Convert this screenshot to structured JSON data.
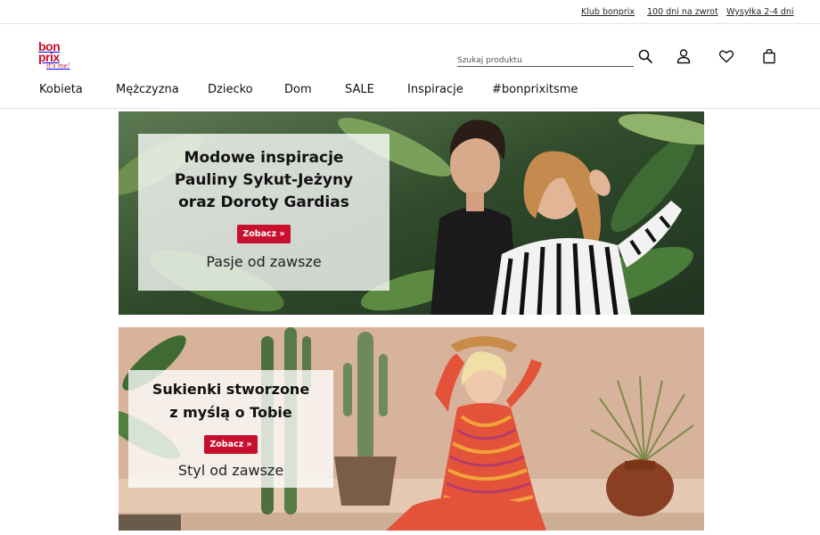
{
  "topbar": {
    "links": [
      "Klub bonprix",
      "100 dni na zwrot",
      "Wysyłka 2-4 dni"
    ]
  },
  "brand": {
    "line1": "bon",
    "line2": "prix",
    "tagline": "it's me!",
    "color": "#c8102e"
  },
  "search": {
    "placeholder": "Szukaj produktu"
  },
  "header_icons": [
    "search-icon",
    "account-icon",
    "wishlist-heart-icon",
    "shopping-bag-icon"
  ],
  "nav": {
    "items": [
      "Kobieta",
      "Mężczyzna",
      "Dziecko",
      "Dom",
      "SALE",
      "Inspiracje",
      "#bonprixitsme"
    ]
  },
  "banners": [
    {
      "title_lines": [
        "Modowe inspiracje",
        "Pauliny Sykut-Jeżyny",
        "oraz Doroty Gardias"
      ],
      "button": "Zobacz »",
      "subtitle": "Pasje od zawsze"
    },
    {
      "title_lines": [
        "Sukienki stworzone",
        "z myślą o Tobie"
      ],
      "button": "Zobacz »",
      "subtitle": "Styl od zawsze"
    }
  ],
  "colors": {
    "accent": "#c8102e",
    "border": "#e6e6e6"
  }
}
